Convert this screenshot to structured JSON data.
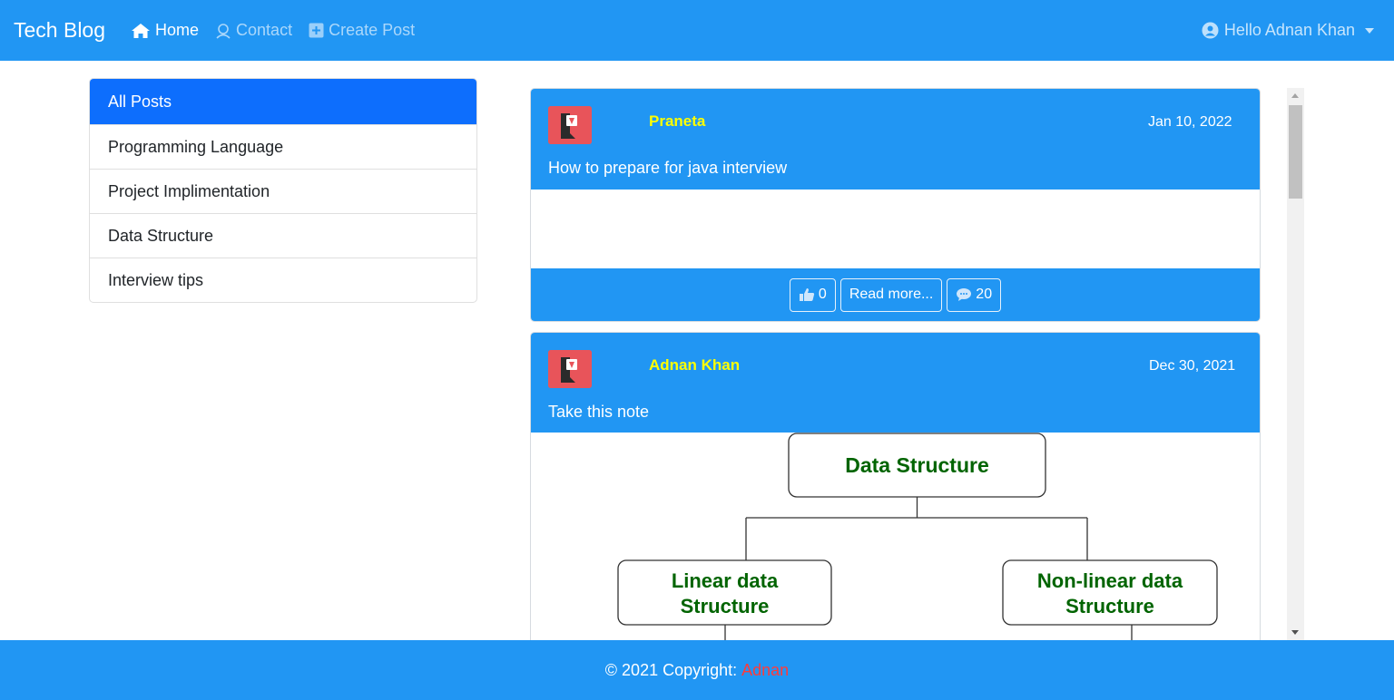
{
  "navbar": {
    "brand": "Tech Blog",
    "links": [
      {
        "label": "Home",
        "icon": "home-icon",
        "active": true
      },
      {
        "label": "Contact",
        "icon": "contact-icon",
        "active": false
      },
      {
        "label": "Create Post",
        "icon": "plus-square-icon",
        "active": false
      }
    ],
    "user_label": "Hello Adnan Khan",
    "user_icon": "user-circle-icon"
  },
  "categories": [
    {
      "label": "All Posts",
      "active": true
    },
    {
      "label": "Programming Language",
      "active": false
    },
    {
      "label": "Project Implimentation",
      "active": false
    },
    {
      "label": "Data Structure",
      "active": false
    },
    {
      "label": "Interview tips",
      "active": false
    }
  ],
  "posts": [
    {
      "author": "Praneta",
      "date": "Jan 10, 2022",
      "title": "How to prepare for java interview",
      "likes": "0",
      "read_more": "Read more...",
      "comments": "20"
    },
    {
      "author": "Adnan Khan",
      "date": "Dec 30, 2021",
      "title": "Take this note",
      "diagram": {
        "root": "Data Structure",
        "left_line1": "Linear data",
        "left_line2": "Structure",
        "right_line1": "Non-linear data",
        "right_line2": "Structure"
      }
    }
  ],
  "footer": {
    "text": "© 2021 Copyright:",
    "owner": "Adnan"
  },
  "colors": {
    "primary": "#2196f3",
    "active_item": "#0d6efd",
    "author": "#ffff00",
    "diagram_text": "#006400",
    "footer_owner": "#ff3b3b"
  }
}
